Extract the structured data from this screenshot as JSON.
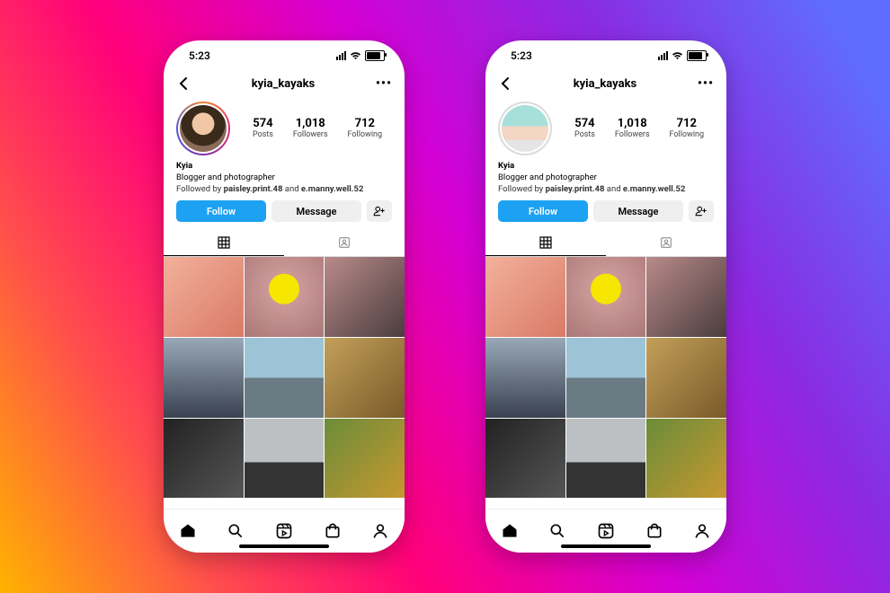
{
  "status": {
    "time": "5:23"
  },
  "header": {
    "username": "kyia_kayaks"
  },
  "profile": {
    "name": "Kyia",
    "subtitle": "Blogger and photographer",
    "followed_prefix": "Followed by ",
    "followed_a": "paisley.print.48",
    "followed_join": " and ",
    "followed_b": "e.manny.well.52",
    "stats": {
      "posts": {
        "value": "574",
        "label": "Posts"
      },
      "followers": {
        "value": "1,018",
        "label": "Followers"
      },
      "following": {
        "value": "712",
        "label": "Following"
      }
    }
  },
  "actions": {
    "follow": "Follow",
    "message": "Message"
  },
  "phones": [
    {
      "avatar_style": "photo",
      "has_story_ring": true
    },
    {
      "avatar_style": "3d-avatar",
      "has_story_ring": false
    }
  ]
}
